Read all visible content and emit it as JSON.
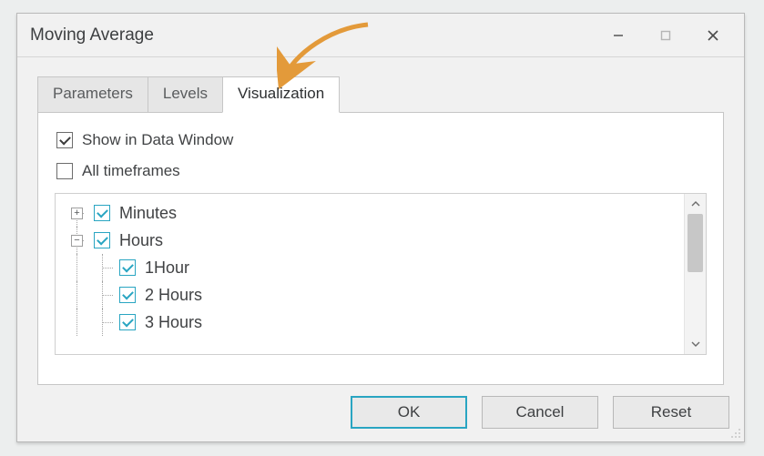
{
  "window": {
    "title": "Moving Average"
  },
  "tabs": {
    "parameters": "Parameters",
    "levels": "Levels",
    "visualization": "Visualization"
  },
  "content": {
    "show_in_data_window": {
      "label": "Show in Data Window",
      "checked": true
    },
    "all_timeframes": {
      "label": "All timeframes",
      "checked": false
    },
    "tree": {
      "minutes": {
        "label": "Minutes",
        "expanded": false,
        "checked": true
      },
      "hours": {
        "label": "Hours",
        "expanded": true,
        "checked": true,
        "children": [
          {
            "label": "1Hour",
            "checked": true
          },
          {
            "label": "2 Hours",
            "checked": true
          },
          {
            "label": "3 Hours",
            "checked": true
          }
        ]
      }
    }
  },
  "buttons": {
    "ok": "OK",
    "cancel": "Cancel",
    "reset": "Reset"
  },
  "expander": {
    "plus": "+",
    "minus": "−"
  }
}
